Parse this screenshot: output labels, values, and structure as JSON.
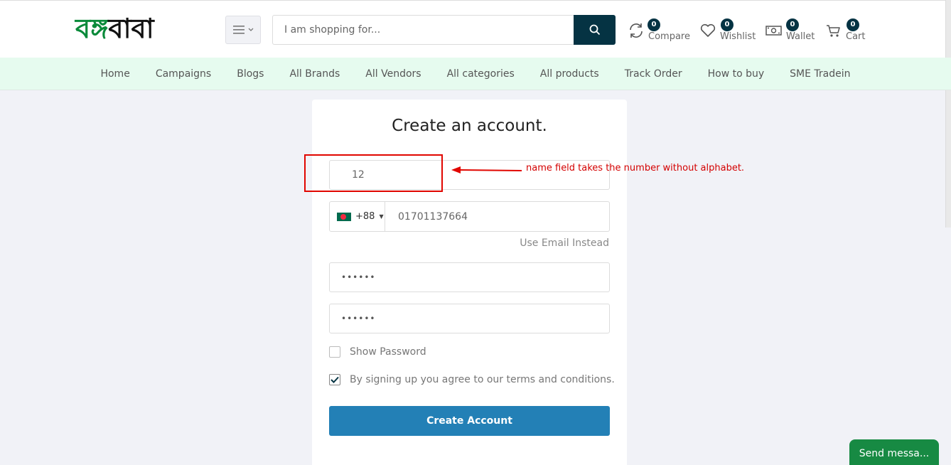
{
  "header": {
    "logo_green": "বঙ্গ",
    "logo_black": "বাবা",
    "search_placeholder": "I am shopping for...",
    "compare": {
      "count": "0",
      "label": "Compare"
    },
    "wishlist": {
      "count": "0",
      "label": "Wishlist"
    },
    "wallet": {
      "count": "0",
      "label": "Wallet"
    },
    "cart": {
      "count": "0",
      "label": "Cart"
    },
    "accent_color": "#053343"
  },
  "nav": {
    "items": [
      "Home",
      "Campaigns",
      "Blogs",
      "All Brands",
      "All Vendors",
      "All categories",
      "All products",
      "Track Order",
      "How to buy",
      "SME Tradein"
    ],
    "background": "#e6fbef"
  },
  "form": {
    "title": "Create an account.",
    "name_value": "12",
    "country_code": "+88",
    "phone_value": "01701137664",
    "use_email_link": "Use Email Instead",
    "password_mask": "••••••",
    "confirm_password_mask": "••••••",
    "show_password_label": "Show Password",
    "show_password_checked": false,
    "terms_label": "By signing up you agree to our terms and conditions.",
    "terms_checked": true,
    "submit_label": "Create Account",
    "submit_color": "#2380b6"
  },
  "annotation": {
    "text": "name field takes the number without alphabet.",
    "color": "#e10600"
  },
  "chat": {
    "label": "Send messa...",
    "color": "#178a43"
  }
}
